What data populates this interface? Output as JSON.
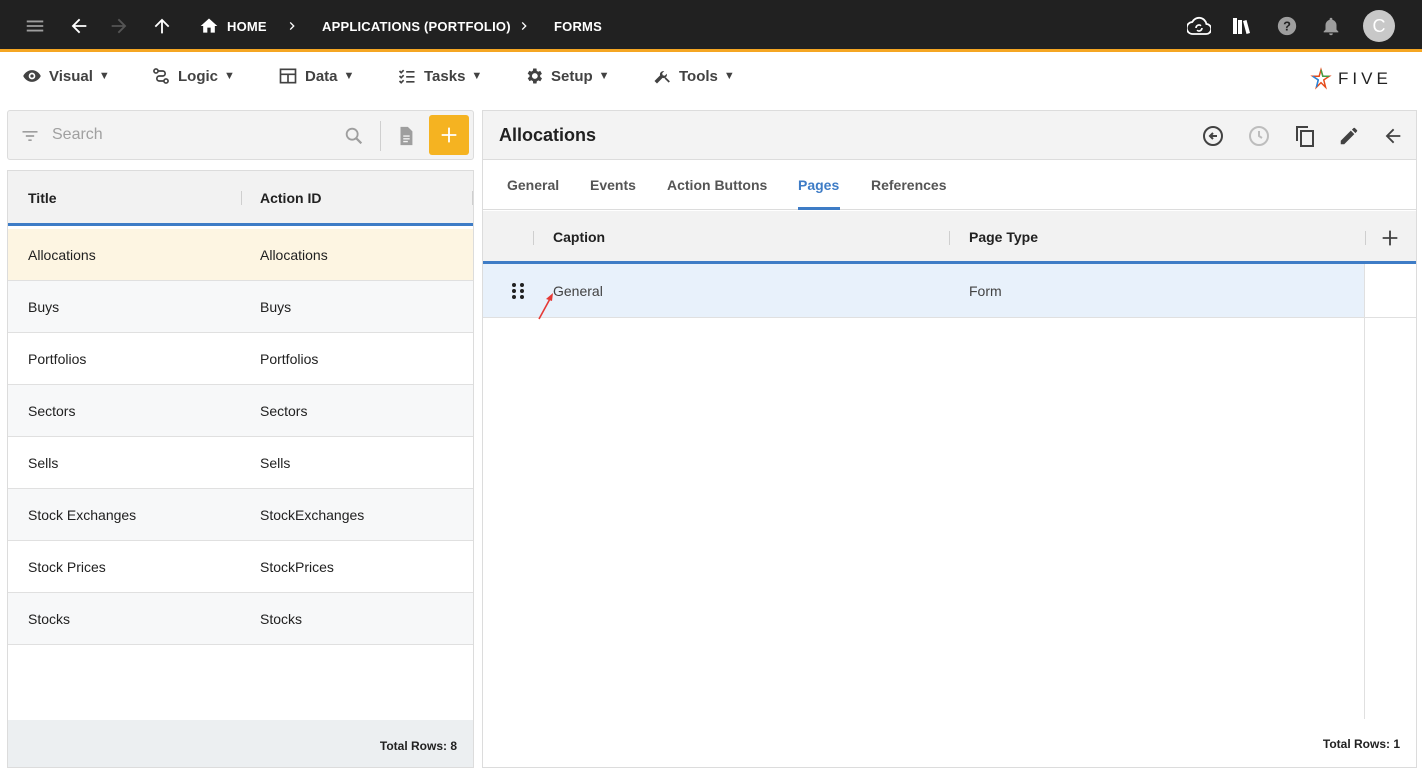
{
  "colors": {
    "topbar": "#212121",
    "accent": "#f5a623",
    "add_button": "#f5b321",
    "primary": "#3e7cc6",
    "selected_row": "#fdf5e2",
    "selected_grid_row": "#e8f1fb"
  },
  "topbar": {
    "breadcrumbs": [
      "HOME",
      "APPLICATIONS (PORTFOLIO)",
      "FORMS"
    ],
    "avatar_letter": "C",
    "icons": [
      "menu-icon",
      "back-arrow-icon",
      "forward-arrow-icon",
      "up-arrow-icon",
      "home-icon",
      "cloud-sync-icon",
      "library-icon",
      "help-icon",
      "notification-bell-icon"
    ]
  },
  "menubar": {
    "items": [
      {
        "label": "Visual",
        "icon": "eye-icon"
      },
      {
        "label": "Logic",
        "icon": "logic-icon"
      },
      {
        "label": "Data",
        "icon": "table-icon"
      },
      {
        "label": "Tasks",
        "icon": "checklist-icon"
      },
      {
        "label": "Setup",
        "icon": "gear-icon"
      },
      {
        "label": "Tools",
        "icon": "tools-icon"
      }
    ],
    "caret": "▼",
    "logo_text": "FIVE"
  },
  "left": {
    "search_placeholder": "Search",
    "columns": [
      "Title",
      "Action ID"
    ],
    "rows": [
      {
        "title": "Allocations",
        "action_id": "Allocations"
      },
      {
        "title": "Buys",
        "action_id": "Buys"
      },
      {
        "title": "Portfolios",
        "action_id": "Portfolios"
      },
      {
        "title": "Sectors",
        "action_id": "Sectors"
      },
      {
        "title": "Sells",
        "action_id": "Sells"
      },
      {
        "title": "Stock Exchanges",
        "action_id": "StockExchanges"
      },
      {
        "title": "Stock Prices",
        "action_id": "StockPrices"
      },
      {
        "title": "Stocks",
        "action_id": "Stocks"
      }
    ],
    "selected_index": 0,
    "footer": "Total Rows: 8"
  },
  "right": {
    "title": "Allocations",
    "tabs": [
      "General",
      "Events",
      "Action Buttons",
      "Pages",
      "References"
    ],
    "active_tab": "Pages",
    "columns": [
      "Caption",
      "Page Type"
    ],
    "rows": [
      {
        "caption": "General",
        "page_type": "Form"
      }
    ],
    "footer": "Total Rows: 1"
  }
}
